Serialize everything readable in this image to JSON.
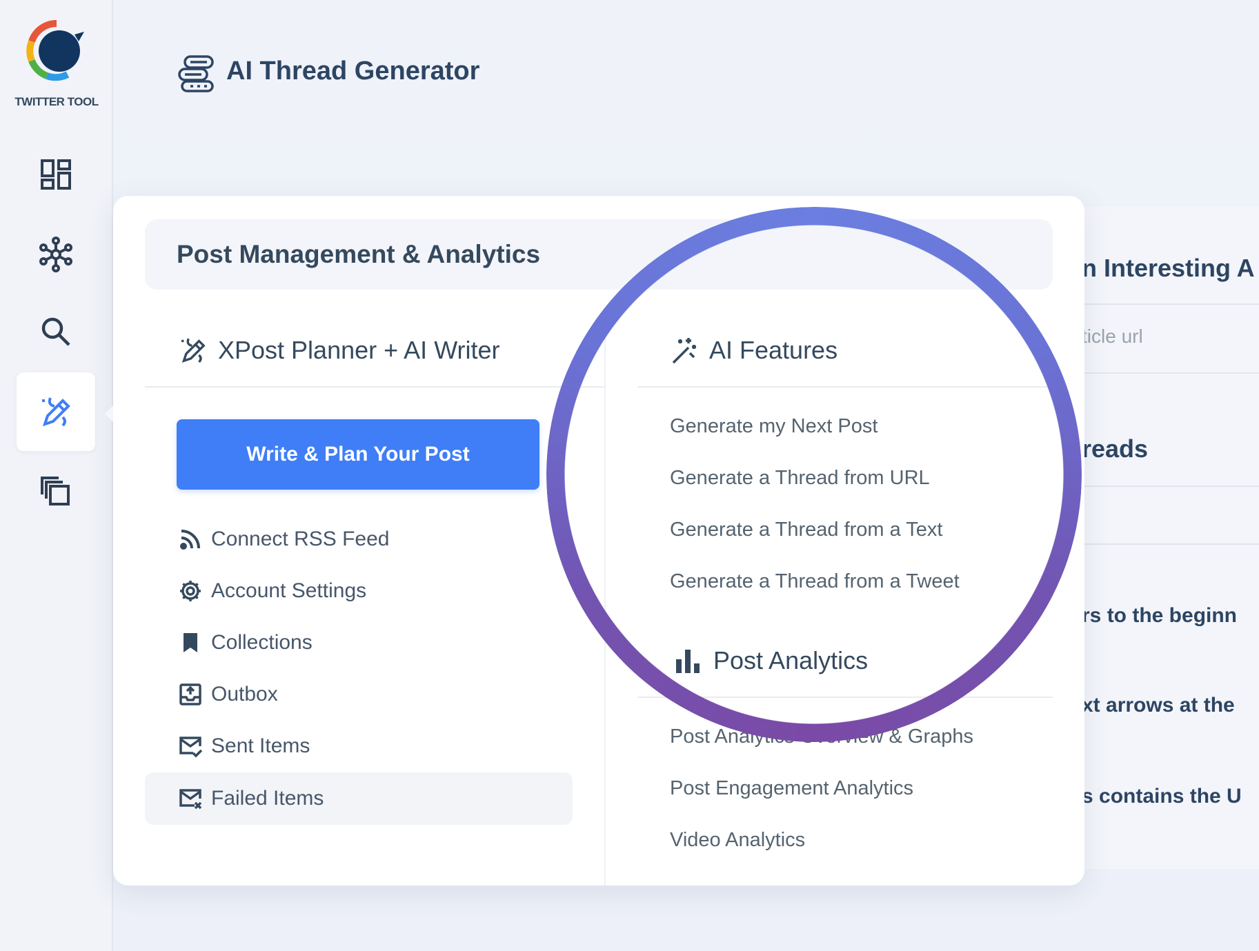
{
  "app": {
    "logo_text": "TWITTER TOOL",
    "page_title": "AI Thread Generator"
  },
  "sidebar": {
    "items": [
      {
        "icon": "dashboard-icon",
        "active": false
      },
      {
        "icon": "network-icon",
        "active": false
      },
      {
        "icon": "search-icon",
        "active": false
      },
      {
        "icon": "pen-sparkle-icon",
        "active": true
      },
      {
        "icon": "copy-icon",
        "active": false
      }
    ]
  },
  "menu": {
    "header_title": "Post Management & Analytics",
    "left": {
      "title": "XPost Planner + AI Writer",
      "cta_label": "Write & Plan Your Post",
      "items": [
        {
          "label": "Connect RSS Feed",
          "icon": "rss-icon"
        },
        {
          "label": "Account Settings",
          "icon": "gear-icon"
        },
        {
          "label": "Collections",
          "icon": "bookmark-icon"
        },
        {
          "label": "Outbox",
          "icon": "outbox-icon"
        },
        {
          "label": "Sent Items",
          "icon": "mail-check-icon"
        },
        {
          "label": "Failed Items",
          "icon": "mail-failed-icon"
        }
      ]
    },
    "ai_features": {
      "title": "AI Features",
      "items": [
        "Generate my Next Post",
        "Generate a Thread from URL",
        "Generate a Thread from a Text",
        "Generate a Thread from a Tweet"
      ]
    },
    "post_analytics": {
      "title": "Post Analytics",
      "items": [
        "Post Analytics Overview & Graphs",
        "Post Engagement Analytics",
        "Video Analytics"
      ]
    }
  },
  "background": {
    "heading1": "n Interesting A",
    "input_placeholder": "ticle url",
    "heading2": "reads",
    "line1": "rs to the beginn",
    "line2": "xt arrows at the",
    "line3": "s contains the U"
  },
  "colors": {
    "primary": "#3f7ef7",
    "ring_top": "#6b7fe0",
    "ring_bottom": "#7a4aa6",
    "text_dark": "#2d4563"
  }
}
